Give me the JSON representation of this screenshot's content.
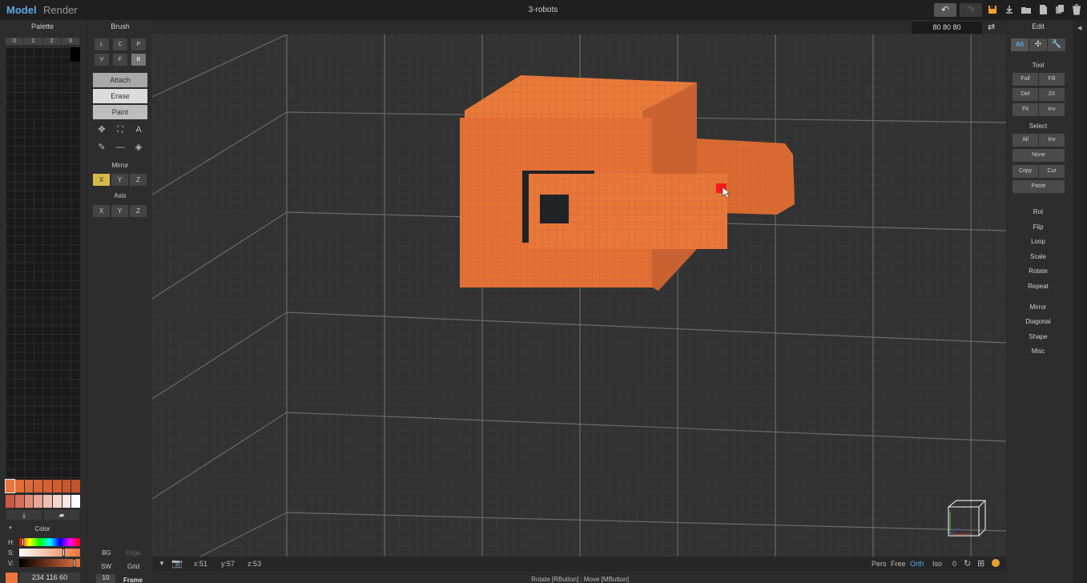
{
  "app": {
    "menu_model": "Model",
    "menu_render": "Render",
    "title": "3-robots"
  },
  "palette": {
    "title": "Palette",
    "tabs": [
      "0",
      "1",
      "2",
      "3"
    ],
    "swatches_row1": [
      "#eb743c",
      "#e36b34",
      "#db6a39",
      "#d86436",
      "#d55f34",
      "#cf5b31",
      "#c9572e",
      "#c2532c"
    ],
    "swatches_row2": [
      "#c85a48",
      "#d56e5a",
      "#e18c7b",
      "#e9a695",
      "#efbfb2",
      "#f4d5cc",
      "#f9e8e2",
      "#ffffff"
    ],
    "color_title": "Color",
    "h_label": "H:",
    "s_label": "S:",
    "v_label": "V:",
    "h_fraction": 0.04,
    "s_fraction": 0.74,
    "v_fraction": 0.92,
    "rgb": "234 116 60"
  },
  "brush": {
    "title": "Brush",
    "row1": [
      "L",
      "C",
      "P"
    ],
    "row2": [
      "V",
      "F",
      "B"
    ],
    "attach": "Attach",
    "erase": "Erase",
    "paint": "Paint",
    "mirror_title": "Mirror",
    "mirror": [
      "X",
      "Y",
      "Z"
    ],
    "axis_title": "Axis",
    "axis": [
      "X",
      "Y",
      "Z"
    ],
    "bg": "BG",
    "edge": "Edge",
    "sw": "SW",
    "grid": "Grid",
    "frame_value": "10",
    "frame": "Frame"
  },
  "viewport": {
    "dims": "80  80  80",
    "accent": "#eb743c",
    "highlight": "#ff1a1a"
  },
  "status": {
    "x": "x:51",
    "y": "y:57",
    "z": "z:53",
    "pers": "Pers",
    "free": "Free",
    "orth": "Orth",
    "iso": "Iso",
    "zero": "0",
    "hint": "Rotate [RButton] : Move [MButton]"
  },
  "edit": {
    "title": "Edit",
    "tab_all": "All",
    "tool_title": "Tool",
    "tool": [
      [
        "Full",
        "Fill"
      ],
      [
        "Del",
        "2X"
      ],
      [
        "Fit",
        "Inv"
      ]
    ],
    "select_title": "Select",
    "select_all": "All",
    "select_inv": "Inv",
    "none": "None",
    "copy": "Copy",
    "cut": "Cut",
    "paste": "Paste",
    "ops": [
      "Rot",
      "Flip",
      "Loop",
      "Scale",
      "Rotate",
      "Repeat"
    ],
    "ops2": [
      "Mirror",
      "Diagonal",
      "Shape",
      "Misc"
    ]
  }
}
